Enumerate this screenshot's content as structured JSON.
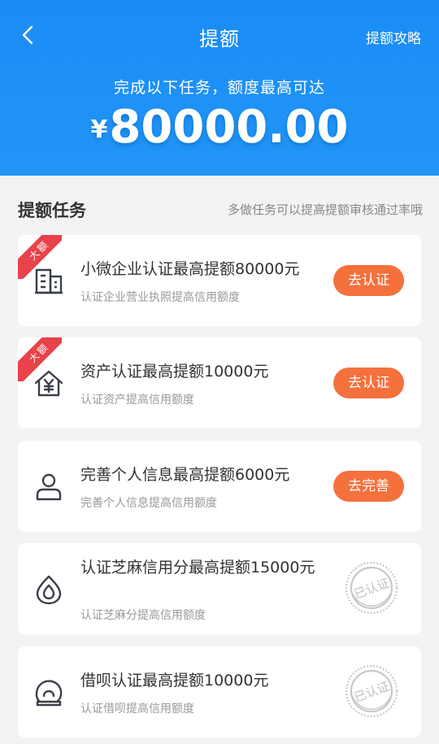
{
  "header": {
    "title": "提额",
    "strategy_label": "提额攻略",
    "subtitle": "完成以下任务，额度最高可达",
    "currency": "¥",
    "amount": "80000.00"
  },
  "section": {
    "title": "提额任务",
    "hint": "多做任务可以提高提额审核通过率哦"
  },
  "tasks": [
    {
      "badge": "大额",
      "icon": "building-icon",
      "title": "小微企业认证最高提额80000元",
      "desc": "认证企业营业执照提高信用额度",
      "action": "去认证",
      "status": "pending"
    },
    {
      "badge": "大额",
      "icon": "house-yen-icon",
      "title": "资产认证最高提额10000元",
      "desc": "认证资产提高信用额度",
      "action": "去认证",
      "status": "pending"
    },
    {
      "badge": "",
      "icon": "person-icon",
      "title": "完善个人信息最高提额6000元",
      "desc": "完善个人信息提高信用额度",
      "action": "去完善",
      "status": "pending"
    },
    {
      "badge": "",
      "icon": "sesame-icon",
      "title": "认证芝麻信用分最高提额15000元",
      "desc": "认证芝麻分提高信用额度",
      "action": "",
      "status": "已认证"
    },
    {
      "badge": "",
      "icon": "huabei-icon",
      "title": "借呗认证最高提额10000元",
      "desc": "认证借呗提高信用额度",
      "action": "",
      "status": "已认证"
    }
  ],
  "colors": {
    "header_blue": "#1a8cf5",
    "button_orange": "#f4713d",
    "badge_red": "#e8424a"
  }
}
